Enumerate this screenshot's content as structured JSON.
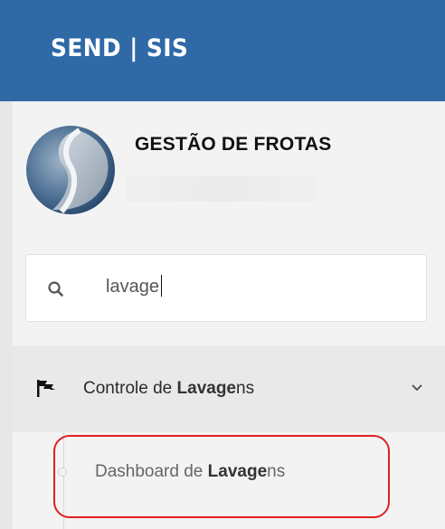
{
  "header": {
    "title": "SEND | SIS",
    "background_color": "#2f6aa6"
  },
  "organization": {
    "name": "GESTÃO DE FROTAS",
    "logo_icon": "company-logo-icon"
  },
  "search": {
    "icon": "search-icon",
    "value": "lavage"
  },
  "menu": {
    "group": {
      "icon": "flag-icon",
      "label_prefix": "Controle de ",
      "label_match": "Lavage",
      "label_suffix": "ns",
      "expand_icon": "chevron-down-icon"
    },
    "items": [
      {
        "label_prefix": "Dashboard de ",
        "label_match": "Lavage",
        "label_suffix": "ns",
        "highlight_color": "#e02020"
      }
    ]
  }
}
